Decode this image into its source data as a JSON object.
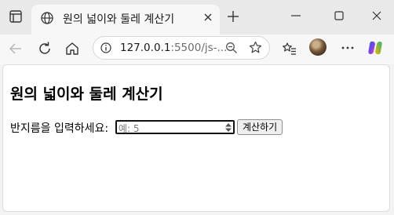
{
  "browser": {
    "tab": {
      "title": "원의 넓이와 둘레 계산기"
    },
    "address": {
      "host": "127.0.0.1",
      "path": ":5500/js-..."
    },
    "icons": {
      "window_menu": "window-icon",
      "favicon": "globe-icon",
      "close_tab": "close-icon",
      "new_tab": "plus-icon",
      "minimize": "minimize-icon",
      "maximize": "maximize-icon",
      "close_window": "close-icon",
      "back": "back-arrow-icon",
      "reload": "reload-icon",
      "home": "home-icon",
      "site_info": "info-icon",
      "zoom": "zoom-out-icon",
      "favorite": "star-icon",
      "favorites": "favorites-icon",
      "profile": "avatar",
      "more": "more-icon",
      "copilot": "copilot-icon"
    }
  },
  "page": {
    "heading": "원의 넓이와 둘레 계산기",
    "form": {
      "label": "반지름을 입력하세요:",
      "placeholder": "예: 5",
      "button_label": "계산하기"
    }
  }
}
